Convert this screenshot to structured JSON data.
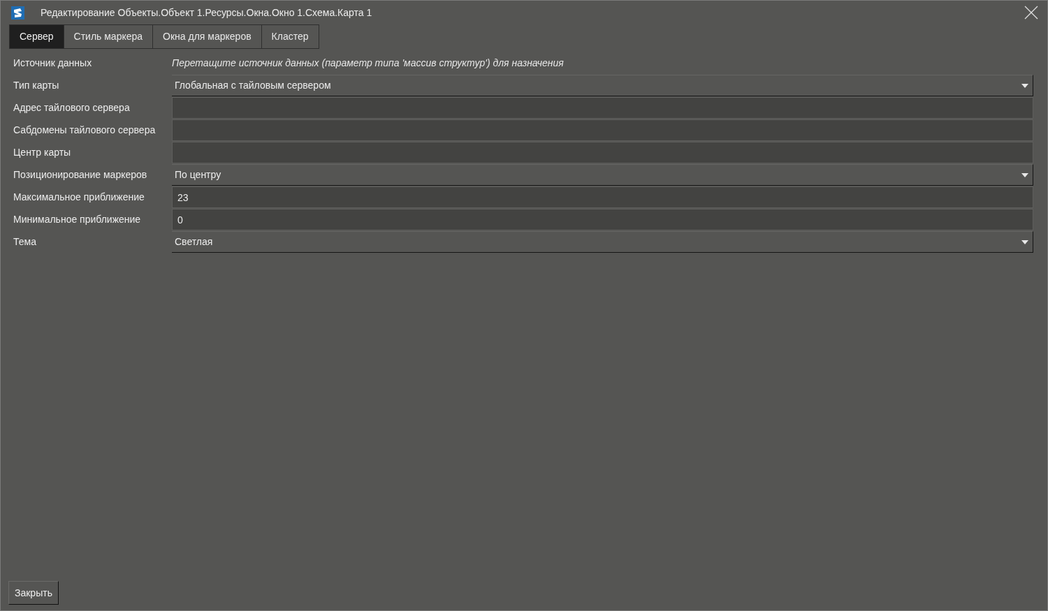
{
  "window": {
    "title": "Редактирование Объекты.Объект 1.Ресурсы.Окна.Окно 1.Схема.Карта 1"
  },
  "tabs": [
    {
      "label": "Сервер",
      "selected": true
    },
    {
      "label": "Стиль маркера",
      "selected": false
    },
    {
      "label": "Окна для маркеров",
      "selected": false
    },
    {
      "label": "Кластер",
      "selected": false
    }
  ],
  "properties": [
    {
      "label": "Источник данных",
      "kind": "hint",
      "hint": "Перетащите источник данных (параметр типа 'массив структур') для назначения"
    },
    {
      "label": "Тип карты",
      "kind": "dropdown",
      "value": "Глобальная с тайловым сервером"
    },
    {
      "label": "Адрес тайлового сервера",
      "kind": "text"
    },
    {
      "label": "Сабдомены тайлового сервера",
      "kind": "text"
    },
    {
      "label": "Центр карты",
      "kind": "text"
    },
    {
      "label": "Позиционирование маркеров",
      "kind": "dropdown",
      "value": "По центру"
    },
    {
      "label": "Максимальное приближение",
      "kind": "text",
      "value": "23"
    },
    {
      "label": "Минимальное приближение",
      "kind": "text",
      "value": "0"
    },
    {
      "label": "Тема",
      "kind": "dropdown",
      "value": "Светлая"
    }
  ],
  "buttons": [
    {
      "label": "Закрыть"
    }
  ]
}
